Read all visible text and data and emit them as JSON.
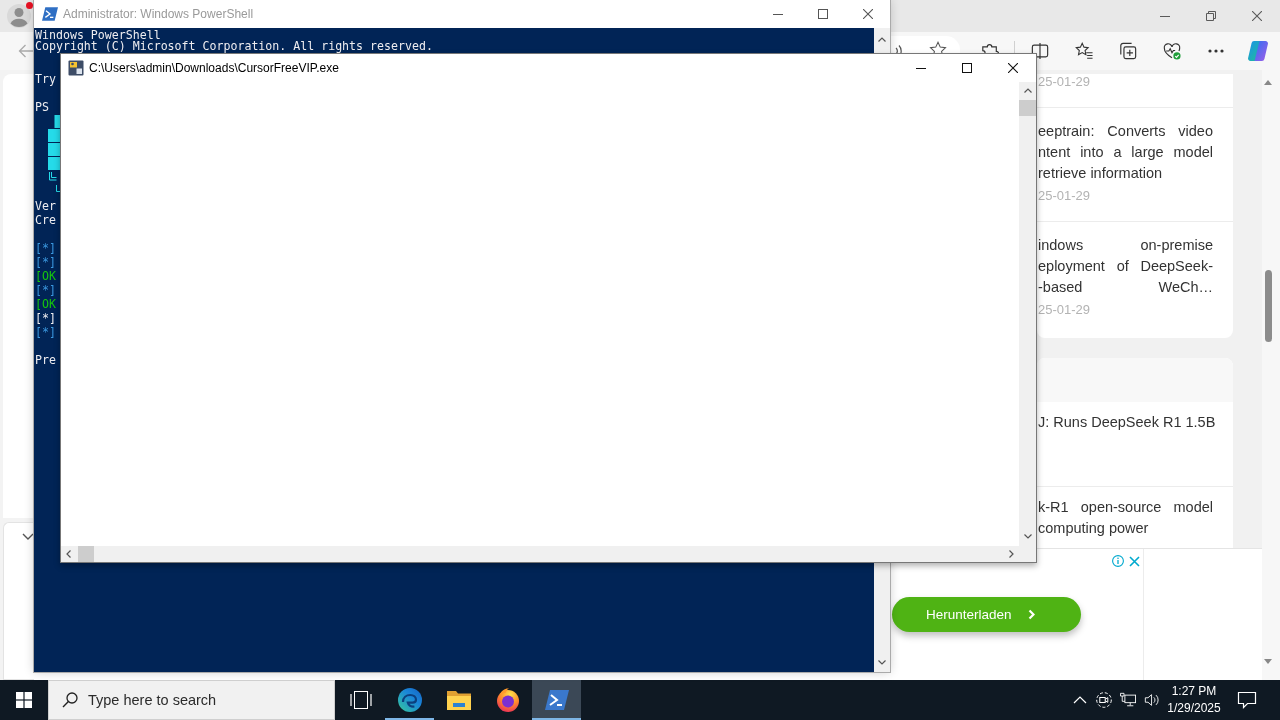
{
  "terminal": {
    "title": "Administrator: Windows PowerShell",
    "active": false,
    "blocks": [
      {
        "lines": [
          {
            "kind": "text",
            "text": "Windows PowerShell",
            "color": "#eeedf0"
          },
          {
            "kind": "text",
            "text": "Copyright (C) Microsoft Corporation. All rights reserved.",
            "color": "#eeedf0"
          }
        ]
      },
      {
        "lines": [
          {
            "kind": "text",
            "text": "Try",
            "color": "#eeedf0"
          }
        ]
      },
      {
        "lines": [
          {
            "kind": "text",
            "text": "PS",
            "color": "#eeedf0"
          },
          {
            "kind": "art"
          },
          {
            "kind": "text",
            "text": "Ver",
            "color": "#eeedf0"
          },
          {
            "kind": "text",
            "text": "Cre",
            "color": "#eeedf0"
          }
        ]
      },
      {
        "lines": [
          {
            "kind": "text",
            "text": "[*]",
            "color": "#3a96dd"
          },
          {
            "kind": "text",
            "text": "[*]",
            "color": "#3a96dd"
          },
          {
            "kind": "text",
            "text": "[OK",
            "color": "#16c60c"
          },
          {
            "kind": "text",
            "text": "[*]",
            "color": "#3a96dd"
          },
          {
            "kind": "text",
            "text": "[OK",
            "color": "#16c60c"
          },
          {
            "kind": "text",
            "text": "[*]",
            "color": "#eeedf0"
          },
          {
            "kind": "text",
            "text": "[*]",
            "color": "#3a96dd"
          }
        ]
      },
      {
        "lines": [
          {
            "kind": "text",
            "text": "Pre",
            "color": "#eeedf0"
          }
        ]
      }
    ]
  },
  "app_window": {
    "title": "C:\\Users\\admin\\Downloads\\CursorFreeVIP.exe",
    "active": true
  },
  "browser": {
    "news_cards": [
      {
        "date": "25-01-29"
      },
      {
        "lines": [
          {
            "text": "eeptrain: Converts video",
            "justified": true
          },
          {
            "text": "ntent into a large model",
            "justified": true
          },
          {
            "text": "retrieve information",
            "justified": false
          }
        ],
        "date": "25-01-29"
      },
      {
        "lines": [
          {
            "text": "indows on-premise",
            "justified": true
          },
          {
            "text": "eployment of DeepSeek-",
            "justified": true
          },
          {
            "text": "-based WeCh…",
            "justified": true
          }
        ],
        "date": "25-01-29"
      }
    ],
    "list_items": [
      {
        "lines": [
          {
            "text": "J: Runs DeepSeek R1 1.5B",
            "justified": true
          }
        ]
      },
      {
        "lines": [
          {
            "text": "k-R1 open-source model",
            "justified": true
          },
          {
            "text": "computing power",
            "justified": false
          }
        ]
      }
    ],
    "ad": {
      "button": "Herunterladen"
    }
  },
  "taskbar": {
    "search": {
      "placeholder": "Type here to search"
    },
    "apps": [
      {
        "kind": "task-view",
        "running": false,
        "selected": false
      },
      {
        "kind": "edge",
        "running": true,
        "selected": false
      },
      {
        "kind": "explorer",
        "running": false,
        "selected": false
      },
      {
        "kind": "firefox",
        "running": false,
        "selected": false
      },
      {
        "kind": "powershell",
        "running": true,
        "selected": true
      }
    ],
    "clock": {
      "time": "1:27 PM",
      "date": "1/29/2025"
    }
  }
}
